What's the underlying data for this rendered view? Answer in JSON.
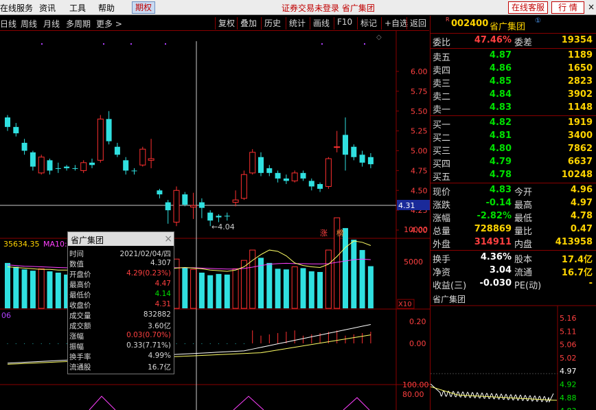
{
  "menu": {
    "items": [
      "在线服务",
      "资讯",
      "工具",
      "帮助"
    ],
    "qiquan": "期权",
    "title": "证券交易未登录 省广集团",
    "online": "在线客服",
    "hangqing": "行 情",
    "close": "×"
  },
  "toolbar": {
    "periods": [
      "日线",
      "周线",
      "月线",
      "多周期",
      "更多 >"
    ],
    "buttons": [
      "复权",
      "叠加",
      "历史",
      "统计",
      "画线",
      "F10",
      "标记",
      "+自选",
      "返回"
    ]
  },
  "stock": {
    "r_mark": "R",
    "code": "002400",
    "name": "省广集团",
    "circle": "①"
  },
  "quote": {
    "weibi_label": "委比",
    "weibi": "47.46%",
    "weicha_label": "委差",
    "weicha": "19354",
    "sell": [
      {
        "label": "卖五",
        "price": "4.87",
        "vol": "1189"
      },
      {
        "label": "卖四",
        "price": "4.86",
        "vol": "1650"
      },
      {
        "label": "卖三",
        "price": "4.85",
        "vol": "2823"
      },
      {
        "label": "卖二",
        "price": "4.84",
        "vol": "3902"
      },
      {
        "label": "卖一",
        "price": "4.83",
        "vol": "1148"
      }
    ],
    "buy": [
      {
        "label": "买一",
        "price": "4.82",
        "vol": "1919"
      },
      {
        "label": "买二",
        "price": "4.81",
        "vol": "3400"
      },
      {
        "label": "买三",
        "price": "4.80",
        "vol": "7862"
      },
      {
        "label": "买四",
        "price": "4.79",
        "vol": "6637"
      },
      {
        "label": "买五",
        "price": "4.78",
        "vol": "10248"
      }
    ],
    "stats": [
      {
        "l1": "现价",
        "v1": "4.83",
        "c1": "green",
        "l2": "今开",
        "v2": "4.96",
        "c2": "green"
      },
      {
        "l1": "涨跌",
        "v1": "-0.14",
        "c1": "green",
        "l2": "最高",
        "v2": "4.97",
        "c2": "white"
      },
      {
        "l1": "涨幅",
        "v1": "-2.82%",
        "c1": "green",
        "l2": "最低",
        "v2": "4.78",
        "c2": "green"
      },
      {
        "l1": "总量",
        "v1": "728869",
        "c1": "yellow",
        "l2": "量比",
        "v2": "0.47",
        "c2": "green"
      },
      {
        "l1": "外盘",
        "v1": "314911",
        "c1": "red",
        "l2": "内盘",
        "v2": "413958",
        "c2": "green"
      }
    ],
    "stats2": [
      {
        "l1": "换手",
        "v1": "4.36%",
        "c1": "white",
        "l2": "股本",
        "v2": "17.4亿",
        "c2": "white"
      },
      {
        "l1": "净资",
        "v1": "3.04",
        "c1": "white",
        "l2": "流通",
        "v2": "16.7亿",
        "c2": "white"
      },
      {
        "l1": "收益(三)",
        "v1": "-0.030",
        "c1": "white",
        "l2": "PE(动)",
        "v2": "-",
        "c2": "white"
      }
    ]
  },
  "mini_chart": {
    "title": "省广集团",
    "labels": [
      "5.16",
      "5.11",
      "5.06",
      "5.02",
      "4.97",
      "4.92",
      "4.88",
      "4.83"
    ],
    "label_colors": [
      "red",
      "red",
      "red",
      "red",
      "white",
      "green",
      "green",
      "green"
    ]
  },
  "kline": {
    "price_ticks": [
      "6.00",
      "5.75",
      "5.50",
      "5.25",
      "5.00",
      "4.75",
      "4.50",
      "4.25",
      "4.00"
    ],
    "cursor_price": "4.31",
    "low_annotation": "←4.04",
    "badge_up": "涨",
    "badge_hot": "榜",
    "volume_label": "35634.35",
    "ma_label": "MA10:",
    "volume_ticks": [
      "10000",
      "5000"
    ],
    "x10": "X10",
    "macd_ticks": [
      "0.20",
      "0.00"
    ],
    "macd_label": "06",
    "kdj_ticks": [
      "100.00",
      "80.00"
    ],
    "colors": {
      "up": "#ff3030",
      "down": "#30e0e0",
      "axis": "#8a0000",
      "ma_yellow": "#ffff66",
      "ma_purple": "#ff40ff"
    }
  },
  "popup": {
    "title": "省广集团",
    "close": "×",
    "rows": [
      {
        "label": "时间",
        "value": "2021/02/04/四",
        "color": ""
      },
      {
        "label": "数值",
        "value": "4.307",
        "color": ""
      },
      {
        "label": "开盘价",
        "value": "4.29(0.23%)",
        "color": "red"
      },
      {
        "label": "最高价",
        "value": "4.47",
        "color": "red"
      },
      {
        "label": "最低价",
        "value": "4.14",
        "color": "green"
      },
      {
        "label": "收盘价",
        "value": "4.31",
        "color": "red"
      },
      {
        "label": "成交量",
        "value": "832882",
        "color": ""
      },
      {
        "label": "成交额",
        "value": "3.60亿",
        "color": ""
      },
      {
        "label": "涨幅",
        "value": "0.03(0.70%)",
        "color": "red"
      },
      {
        "label": "振幅",
        "value": "0.33(7.71%)",
        "color": ""
      },
      {
        "label": "换手率",
        "value": "4.99%",
        "color": ""
      },
      {
        "label": "流通股",
        "value": "16.7亿",
        "color": ""
      }
    ]
  },
  "chart_data": {
    "type": "candlestick",
    "price_axis": [
      4.0,
      6.0
    ],
    "candles": [
      {
        "o": 5.42,
        "h": 5.45,
        "l": 5.25,
        "c": 5.3,
        "up": false
      },
      {
        "o": 5.3,
        "h": 5.35,
        "l": 5.18,
        "c": 5.22,
        "up": false
      },
      {
        "o": 5.1,
        "h": 5.15,
        "l": 4.95,
        "c": 5.0,
        "up": false
      },
      {
        "o": 4.98,
        "h": 5.0,
        "l": 4.75,
        "c": 4.8,
        "up": false
      },
      {
        "o": 4.72,
        "h": 4.95,
        "l": 4.7,
        "c": 4.92,
        "up": true
      },
      {
        "o": 4.88,
        "h": 4.9,
        "l": 4.7,
        "c": 4.75,
        "up": false
      },
      {
        "o": 4.78,
        "h": 4.85,
        "l": 4.72,
        "c": 4.78,
        "up": false
      },
      {
        "o": 4.8,
        "h": 4.82,
        "l": 4.75,
        "c": 4.78,
        "up": false
      },
      {
        "o": 4.78,
        "h": 4.82,
        "l": 4.75,
        "c": 4.78,
        "up": false
      },
      {
        "o": 4.75,
        "h": 4.88,
        "l": 4.72,
        "c": 4.85,
        "up": true
      },
      {
        "o": 4.85,
        "h": 4.9,
        "l": 4.78,
        "c": 4.82,
        "up": false
      },
      {
        "o": 4.88,
        "h": 5.45,
        "l": 4.85,
        "c": 5.4,
        "up": true
      },
      {
        "o": 5.4,
        "h": 5.5,
        "l": 5.08,
        "c": 5.12,
        "up": false
      },
      {
        "o": 5.05,
        "h": 5.1,
        "l": 4.92,
        "c": 4.95,
        "up": false
      },
      {
        "o": 4.88,
        "h": 4.92,
        "l": 4.7,
        "c": 4.75,
        "up": false
      },
      {
        "o": 4.75,
        "h": 4.78,
        "l": 4.7,
        "c": 4.75,
        "up": false
      },
      {
        "o": 4.82,
        "h": 5.05,
        "l": 4.8,
        "c": 5.02,
        "up": true
      },
      {
        "o": 4.88,
        "h": 5.15,
        "l": 4.78,
        "c": 4.9,
        "up": true
      },
      {
        "o": 4.5,
        "h": 4.52,
        "l": 4.4,
        "c": 4.45,
        "up": false
      },
      {
        "o": 4.35,
        "h": 4.38,
        "l": 4.08,
        "c": 4.25,
        "up": false
      },
      {
        "o": 4.1,
        "h": 4.55,
        "l": 4.05,
        "c": 4.5,
        "up": true
      },
      {
        "o": 4.45,
        "h": 4.48,
        "l": 4.3,
        "c": 4.32,
        "up": false
      },
      {
        "o": 4.29,
        "h": 4.47,
        "l": 4.14,
        "c": 4.31,
        "up": true
      },
      {
        "o": 4.35,
        "h": 4.4,
        "l": 4.15,
        "c": 4.28,
        "up": false
      },
      {
        "o": 4.22,
        "h": 4.25,
        "l": 4.05,
        "c": 4.12,
        "up": false
      },
      {
        "o": 4.18,
        "h": 4.2,
        "l": 4.1,
        "c": 4.16,
        "up": false
      },
      {
        "o": 4.18,
        "h": 4.22,
        "l": 4.12,
        "c": 4.18,
        "up": false
      },
      {
        "o": 4.35,
        "h": 4.5,
        "l": 4.3,
        "c": 4.38,
        "up": true
      },
      {
        "o": 4.4,
        "h": 4.75,
        "l": 4.38,
        "c": 4.7,
        "up": true
      },
      {
        "o": 4.72,
        "h": 5.02,
        "l": 4.7,
        "c": 4.98,
        "up": true
      },
      {
        "o": 4.92,
        "h": 4.98,
        "l": 4.68,
        "c": 4.72,
        "up": false
      },
      {
        "o": 4.78,
        "h": 4.82,
        "l": 4.68,
        "c": 4.72,
        "up": false
      },
      {
        "o": 4.72,
        "h": 4.75,
        "l": 4.6,
        "c": 4.65,
        "up": false
      },
      {
        "o": 4.65,
        "h": 4.7,
        "l": 4.58,
        "c": 4.62,
        "up": false
      },
      {
        "o": 4.62,
        "h": 4.75,
        "l": 4.6,
        "c": 4.72,
        "up": true
      },
      {
        "o": 4.72,
        "h": 4.75,
        "l": 4.62,
        "c": 4.65,
        "up": false
      },
      {
        "o": 4.62,
        "h": 4.65,
        "l": 4.5,
        "c": 4.55,
        "up": false
      },
      {
        "o": 4.58,
        "h": 4.6,
        "l": 4.48,
        "c": 4.52,
        "up": false
      },
      {
        "o": 4.55,
        "h": 4.92,
        "l": 4.52,
        "c": 4.9,
        "up": true
      },
      {
        "o": 5.05,
        "h": 5.25,
        "l": 4.98,
        "c": 5.05,
        "up": true
      },
      {
        "o": 5.2,
        "h": 5.42,
        "l": 4.75,
        "c": 4.95,
        "up": false
      },
      {
        "o": 5.05,
        "h": 5.08,
        "l": 4.88,
        "c": 4.92,
        "up": false
      },
      {
        "o": 4.95,
        "h": 5.0,
        "l": 4.8,
        "c": 4.85,
        "up": false
      },
      {
        "o": 4.92,
        "h": 4.97,
        "l": 4.78,
        "c": 4.83,
        "up": false
      }
    ],
    "volumes": [
      4800,
      4200,
      3800,
      3600,
      3900,
      3500,
      3300,
      3000,
      3100,
      3400,
      3200,
      5200,
      4800,
      4000,
      3500,
      3200,
      4200,
      5000,
      3600,
      3200,
      5400,
      4100,
      3800,
      3300,
      2900,
      3100,
      3000,
      3900,
      5200,
      6800,
      5600,
      4800,
      3900,
      3800,
      4200,
      4000,
      3500,
      3400,
      6800,
      11800,
      10200,
      8400,
      6800,
      4300
    ],
    "ma_yellow": [
      4200,
      4100,
      4000,
      3900,
      3800,
      3800,
      3700,
      3700,
      3600,
      3600,
      3600,
      3700,
      3800,
      3900,
      3900,
      3900,
      4000,
      4100,
      4000,
      3900,
      4000,
      4100,
      4000,
      3900,
      3700,
      3600,
      3500,
      3700,
      4200,
      5200,
      6100,
      6800,
      6600,
      5900,
      4800,
      4400,
      4200,
      4100,
      4600,
      5800,
      7200,
      8200,
      8000,
      7500
    ],
    "ma_purple": [
      4500,
      4400,
      4300,
      4250,
      4200,
      4150,
      4100,
      4050,
      4000,
      3950,
      3950,
      4000,
      4050,
      4050,
      4050,
      4050,
      4050,
      4100,
      4100,
      4050,
      4050,
      4050,
      4050,
      4000,
      3950,
      3900,
      3850,
      3850,
      3950,
      4150,
      4400,
      4600,
      4700,
      4750,
      4700,
      4700,
      4650,
      4650,
      4700,
      4900,
      5100,
      5300,
      5400,
      5300
    ]
  }
}
